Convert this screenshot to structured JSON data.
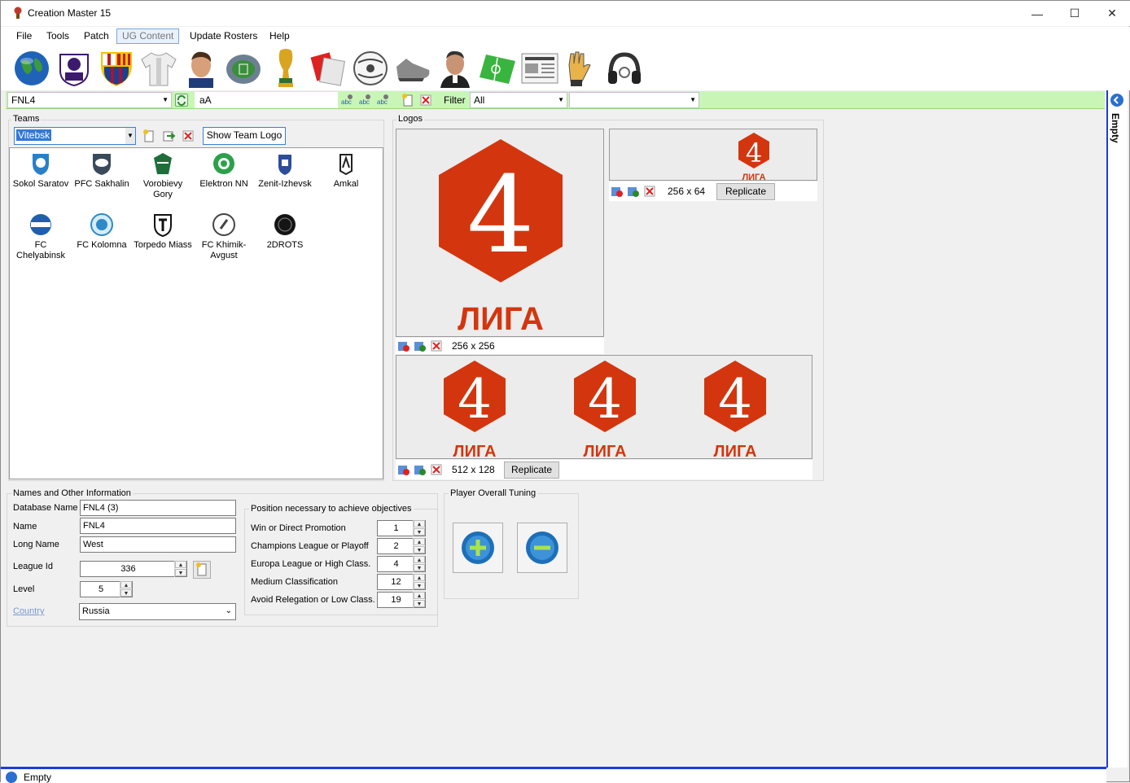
{
  "window": {
    "title": "Creation Master 15"
  },
  "menu": {
    "items": [
      {
        "label": "File"
      },
      {
        "label": "Tools"
      },
      {
        "label": "Patch"
      },
      {
        "label": "UG Content"
      },
      {
        "label": "Update Rosters"
      },
      {
        "label": "Help"
      }
    ]
  },
  "toolbar": {
    "icons": [
      "globe-icon",
      "premier-league-icon",
      "barcelona-crest-icon",
      "jersey-icon",
      "player-face-icon",
      "stadium-icon",
      "trophy-icon",
      "cards-icon",
      "ball-icon",
      "boots-icon",
      "manager-icon",
      "pitch-icon",
      "newspaper-icon",
      "gloves-icon",
      "headphones-icon"
    ]
  },
  "greenbar": {
    "league_value": "FNL4",
    "font_toggle_label": "aA",
    "filter_label": "Filter",
    "filter_value": "All",
    "second_filter_value": ""
  },
  "teams": {
    "group_label": "Teams",
    "selected_team": "Vitebsk",
    "show_logo_button": "Show Team Logo",
    "list": [
      {
        "name": "Sokol Saratov",
        "color": "#2a7fc7"
      },
      {
        "name": "PFC Sakhalin",
        "color": "#3a4a5a"
      },
      {
        "name": "Vorobievy Gory",
        "color": "#1f6e3a"
      },
      {
        "name": "Elektron NN",
        "color": "#2aa14a"
      },
      {
        "name": "Zenit-Izhevsk",
        "color": "#2c4e9a"
      },
      {
        "name": "Amkal",
        "color": "#222222"
      },
      {
        "name": "FC Chelyabinsk",
        "color": "#1f5fb0"
      },
      {
        "name": "FC Kolomna",
        "color": "#2e8ac6"
      },
      {
        "name": "Torpedo Miass",
        "color": "#111111"
      },
      {
        "name": "FC Khimik-Avgust",
        "color": "#444444"
      },
      {
        "name": "2DROTS",
        "color": "#151515"
      }
    ]
  },
  "logos": {
    "group_label": "Logos",
    "logo_number": "4",
    "logo_word": "ЛИГА",
    "brand_color": "#d3360e",
    "size_large": "256 x 256",
    "size_small": "256 x 64",
    "size_wide": "512 x 128",
    "replicate_label": "Replicate"
  },
  "info": {
    "group_label": "Names and Other Information",
    "database_name_label": "Database Name",
    "database_name_value": "FNL4 (3)",
    "name_label": "Name",
    "name_value": "FNL4",
    "long_name_label": "Long Name",
    "long_name_value": "West",
    "league_id_label": "League Id",
    "league_id_value": "336",
    "level_label": "Level",
    "level_value": "5",
    "country_label": "Country",
    "country_value": "Russia"
  },
  "objectives": {
    "group_label": "Position necessary to achieve objectives",
    "rows": [
      {
        "label": "Win or Direct Promotion",
        "value": "1"
      },
      {
        "label": "Champions League or Playoff",
        "value": "2"
      },
      {
        "label": "Europa League or High Class.",
        "value": "4"
      },
      {
        "label": "Medium Classification",
        "value": "12"
      },
      {
        "label": "Avoid Relegation or Low Class.",
        "value": "19"
      }
    ]
  },
  "tuning": {
    "group_label": "Player Overall Tuning"
  },
  "side_panel": {
    "label": "Empty"
  },
  "bottom_panel": {
    "label": "Empty"
  }
}
